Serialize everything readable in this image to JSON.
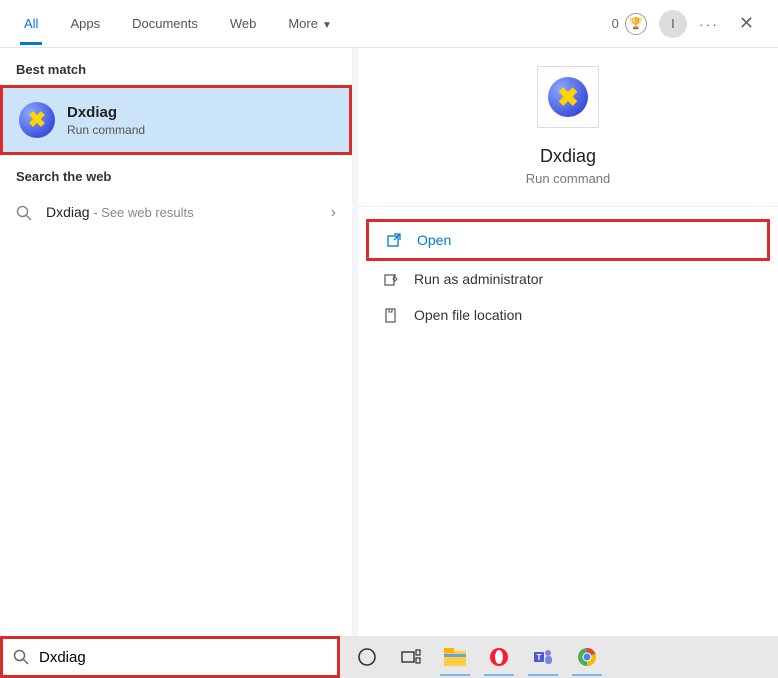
{
  "header": {
    "tabs": [
      "All",
      "Apps",
      "Documents",
      "Web",
      "More"
    ],
    "active_tab_index": 0,
    "reward_count": "0",
    "avatar_initial": "I"
  },
  "left": {
    "best_match_label": "Best match",
    "best_match": {
      "title": "Dxdiag",
      "subtitle": "Run command"
    },
    "web_label": "Search the web",
    "web_item": {
      "title": "Dxdiag",
      "subtitle": " - See web results"
    }
  },
  "right": {
    "title": "Dxdiag",
    "subtitle": "Run command",
    "actions": [
      {
        "label": "Open",
        "icon": "open",
        "highlighted": true
      },
      {
        "label": "Run as administrator",
        "icon": "admin",
        "highlighted": false
      },
      {
        "label": "Open file location",
        "icon": "folder",
        "highlighted": false
      }
    ]
  },
  "search": {
    "value": "Dxdiag"
  },
  "taskbar_icons": [
    "cortana",
    "taskview",
    "explorer",
    "opera",
    "teams",
    "chrome"
  ]
}
